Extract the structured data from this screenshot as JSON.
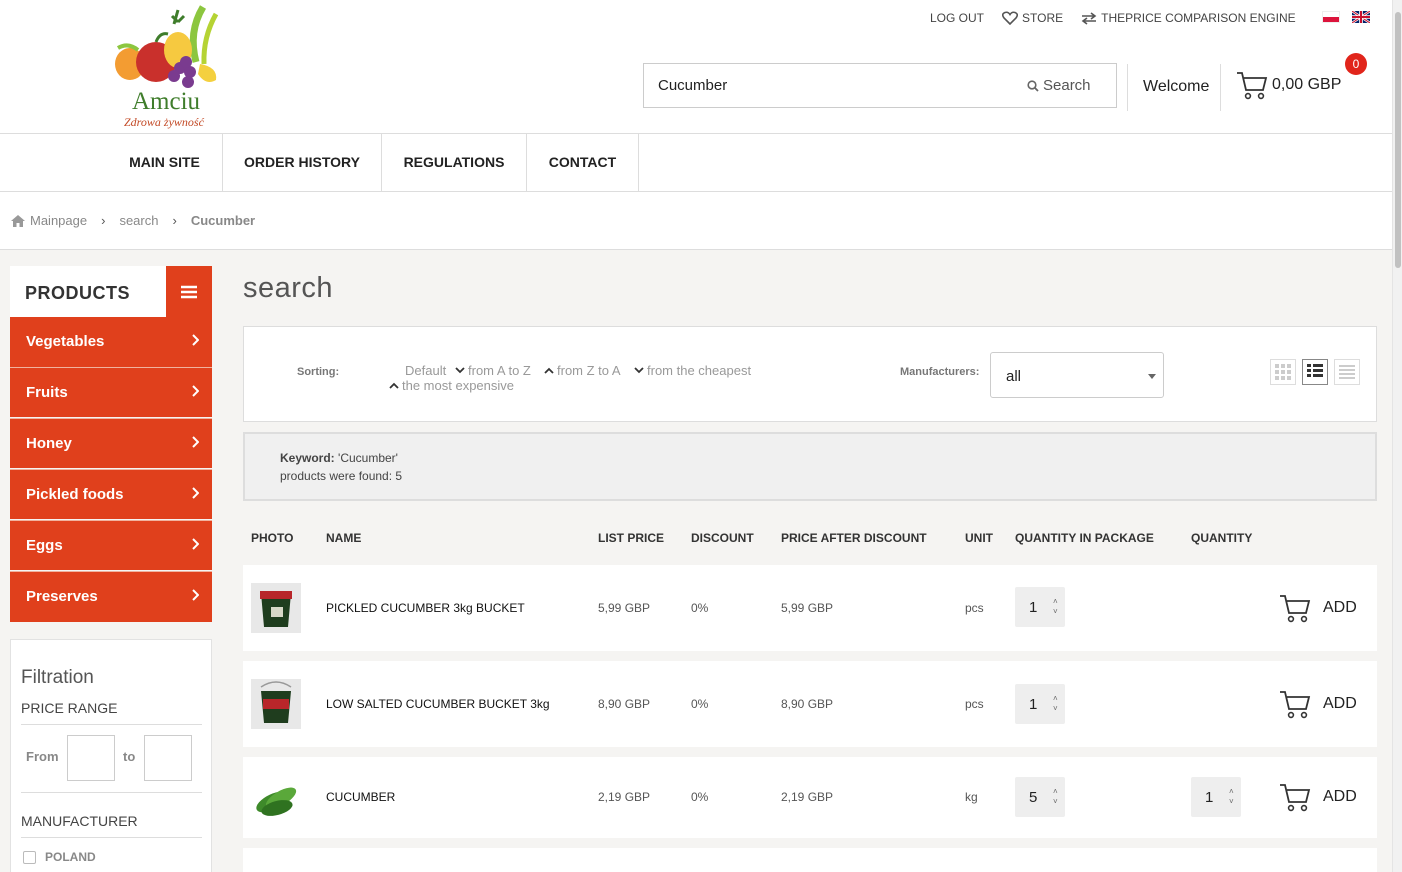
{
  "header": {
    "logo_name": "Amciu",
    "logo_tagline": "Zdrowa żywność",
    "top_links": {
      "logout": "LOG OUT",
      "store": "STORE",
      "compare": "THEPRICE COMPARISON ENGINE"
    },
    "search": {
      "value": "Cucumber",
      "button_label": "Search"
    },
    "welcome": "Welcome",
    "cart": {
      "total": "0,00 GBP",
      "count": "0"
    }
  },
  "nav": {
    "items": [
      {
        "label": "MAIN SITE"
      },
      {
        "label": "ORDER HISTORY"
      },
      {
        "label": "REGULATIONS"
      },
      {
        "label": "CONTACT"
      }
    ]
  },
  "breadcrumb": {
    "home": "Mainpage",
    "level1": "search",
    "current": "Cucumber"
  },
  "sidebar": {
    "title": "PRODUCTS",
    "categories": [
      {
        "label": "Vegetables"
      },
      {
        "label": "Fruits"
      },
      {
        "label": "Honey"
      },
      {
        "label": "Pickled foods"
      },
      {
        "label": "Eggs"
      },
      {
        "label": "Preserves"
      }
    ],
    "filter": {
      "title": "Filtration",
      "price_range": "PRICE RANGE",
      "from": "From",
      "to": "to",
      "manufacturer": "MANUFACTURER",
      "option": "POLAND"
    }
  },
  "main": {
    "title": "search",
    "sorting": {
      "label": "Sorting:",
      "options": [
        "Default",
        "from A to Z",
        "from Z to A",
        "from the cheapest",
        "the most expensive"
      ]
    },
    "manufacturers": {
      "label": "Manufacturers:",
      "value": "all"
    },
    "keyword": {
      "label": "Keyword:",
      "value": "'Cucumber'",
      "count_text": "products were found: 5"
    },
    "columns": {
      "photo": "PHOTO",
      "name": "NAME",
      "list_price": "LIST PRICE",
      "discount": "DISCOUNT",
      "price_after": "PRICE AFTER DISCOUNT",
      "unit": "UNIT",
      "qty_pkg": "QUANTITY IN PACKAGE",
      "qty": "QUANTITY"
    },
    "add_label": "ADD",
    "products": [
      {
        "name": "PICKLED CUCUMBER 3kg BUCKET",
        "list_price": "5,99 GBP",
        "discount": "0%",
        "price_after": "5,99 GBP",
        "unit": "pcs",
        "qty_pkg": "1",
        "qty": ""
      },
      {
        "name": "LOW SALTED CUCUMBER BUCKET 3kg",
        "list_price": "8,90 GBP",
        "discount": "0%",
        "price_after": "8,90 GBP",
        "unit": "pcs",
        "qty_pkg": "1",
        "qty": ""
      },
      {
        "name": "CUCUMBER",
        "list_price": "2,19 GBP",
        "discount": "0%",
        "price_after": "2,19 GBP",
        "unit": "kg",
        "qty_pkg": "5",
        "qty": "1"
      }
    ]
  }
}
